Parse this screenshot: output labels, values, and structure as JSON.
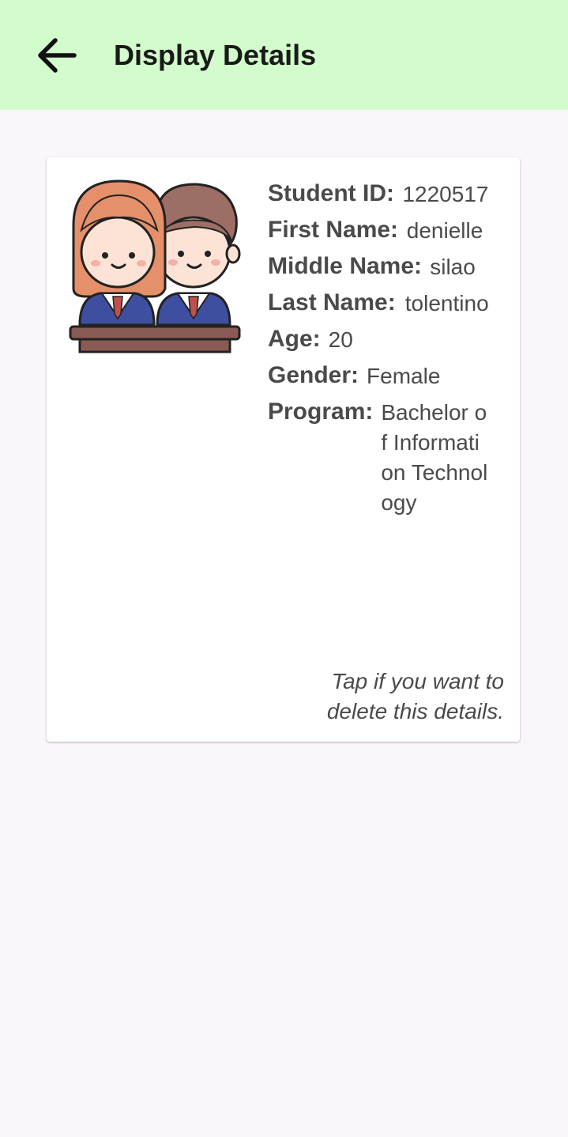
{
  "app_bar": {
    "title": "Display Details",
    "back_icon": "arrow-left-icon"
  },
  "card": {
    "avatar_icon": "students-at-desk-icon",
    "fields": {
      "student_id": {
        "label": "Student ID:",
        "value": "1220517"
      },
      "first_name": {
        "label": "First Name:",
        "value": "denielle"
      },
      "middle_name": {
        "label": "Middle Name:",
        "value": "silao"
      },
      "last_name": {
        "label": "Last Name:",
        "value": "tolentino"
      },
      "age": {
        "label": "Age:",
        "value": "20"
      },
      "gender": {
        "label": "Gender:",
        "value": "Female"
      },
      "program": {
        "label": "Program:",
        "value": "Bachelor of Information Technology"
      }
    },
    "hint": "Tap if you want to delete this details."
  },
  "colors": {
    "app_bar_bg": "#d2fccb",
    "page_bg": "#fbf5fc",
    "card_bg": "#ffffff",
    "text": "#4a4a4a"
  }
}
